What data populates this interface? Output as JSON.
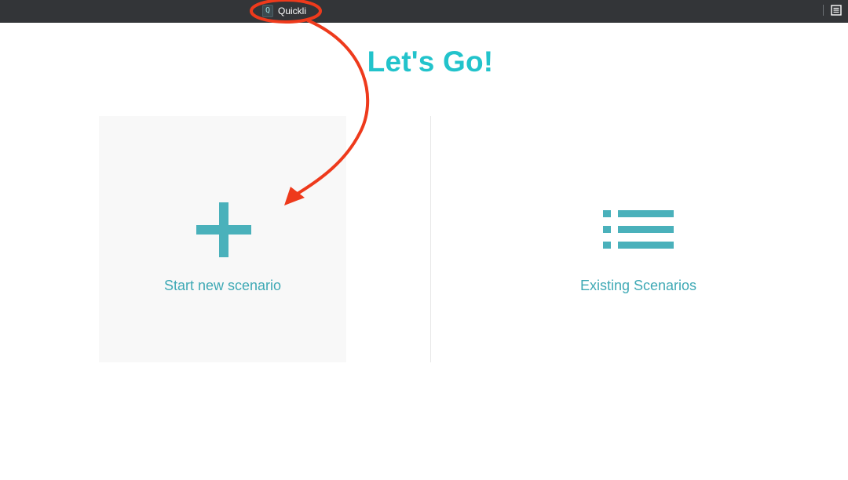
{
  "topbar": {
    "app_icon_letter": "Q",
    "app_name": "Quickli",
    "menu_icon": "list-menu-icon"
  },
  "main": {
    "heading": "Let's Go!",
    "new_card": {
      "label": "Start new scenario",
      "icon": "plus-icon"
    },
    "existing_card": {
      "label": "Existing Scenarios",
      "icon": "list-icon"
    }
  },
  "colors": {
    "accent_heading": "#22c3cb",
    "accent_icon": "#4ab1bb",
    "topbar_bg": "#333538",
    "annotation": "#ee3a1c"
  }
}
